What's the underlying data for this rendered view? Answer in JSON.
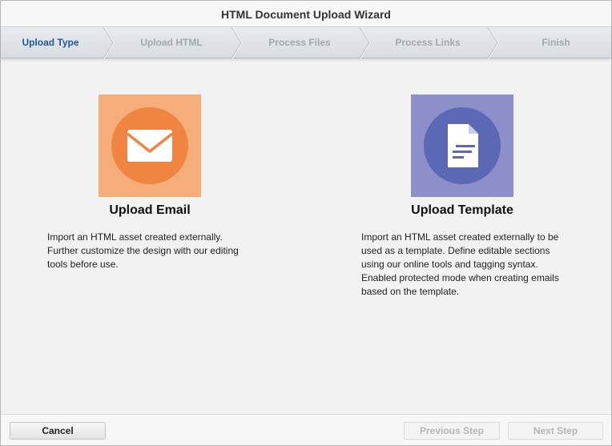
{
  "window": {
    "title": "HTML Document Upload Wizard"
  },
  "steps": [
    {
      "label": "Upload Type",
      "active": true
    },
    {
      "label": "Upload HTML",
      "active": false
    },
    {
      "label": "Process Files",
      "active": false
    },
    {
      "label": "Process Links",
      "active": false
    },
    {
      "label": "Finish",
      "active": false
    }
  ],
  "options": [
    {
      "title": "Upload Email",
      "icon": "envelope-icon",
      "color": "#f5ae7a",
      "circle_color": "#ef8540",
      "lines": [
        "Import an HTML asset created externally.",
        "Further customize the design with our editing",
        "tools before use."
      ]
    },
    {
      "title": "Upload Template",
      "icon": "document-icon",
      "color": "#8c8fc9",
      "circle_color": "#5b68b3",
      "lines": [
        "Import an HTML asset created externally to be",
        "used as a template. Define editable sections",
        "using our online tools and tagging syntax.",
        "Enabled protected mode when creating emails",
        "based on the template."
      ]
    }
  ],
  "footer": {
    "cancel_label": "Cancel",
    "previous_label": "Previous Step",
    "next_label": "Next Step"
  }
}
